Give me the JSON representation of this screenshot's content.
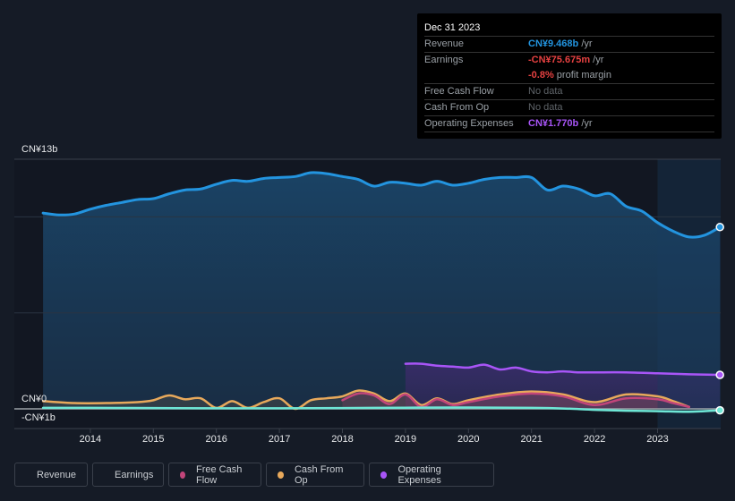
{
  "tooltip": {
    "date": "Dec 31 2023",
    "rows": [
      {
        "label": "Revenue",
        "value": "CN¥9.468b",
        "unit": " /yr"
      },
      {
        "label": "Earnings",
        "value": "-CN¥75.675m",
        "unit": " /yr"
      },
      {
        "label": "",
        "value": "-0.8%",
        "unit": " profit margin"
      },
      {
        "label": "Free Cash Flow",
        "value": "No data",
        "unit": ""
      },
      {
        "label": "Cash From Op",
        "value": "No data",
        "unit": ""
      },
      {
        "label": "Operating Expenses",
        "value": "CN¥1.770b",
        "unit": " /yr"
      }
    ]
  },
  "legend": [
    {
      "label": "Revenue",
      "color": "#2394df"
    },
    {
      "label": "Earnings",
      "color": "#6ee7d6"
    },
    {
      "label": "Free Cash Flow",
      "color": "#c2457a"
    },
    {
      "label": "Cash From Op",
      "color": "#e8a95b"
    },
    {
      "label": "Operating Expenses",
      "color": "#a855f7"
    }
  ],
  "chart_data": {
    "type": "area",
    "title": "",
    "xlabel": "",
    "ylabel": "",
    "y_tick_labels": [
      "CN¥13b",
      "CN¥0",
      "-CN¥1b"
    ],
    "x_tick_labels": [
      "2014",
      "2015",
      "2016",
      "2017",
      "2018",
      "2019",
      "2020",
      "2021",
      "2022",
      "2023"
    ],
    "ylim": [
      -1,
      13
    ],
    "xlim": [
      2013,
      2024
    ],
    "grid": true,
    "forecast_shading_from": 2023.0,
    "legend_position": "bottom-left",
    "series": [
      {
        "name": "Revenue",
        "color": "#2394df",
        "unit": "CN¥b",
        "x": [
          2013.25,
          2013.5,
          2013.75,
          2014.0,
          2014.25,
          2014.5,
          2014.75,
          2015.0,
          2015.25,
          2015.5,
          2015.75,
          2016.0,
          2016.25,
          2016.5,
          2016.75,
          2017.0,
          2017.25,
          2017.5,
          2017.75,
          2018.0,
          2018.25,
          2018.5,
          2018.75,
          2019.0,
          2019.25,
          2019.5,
          2019.75,
          2020.0,
          2020.25,
          2020.5,
          2020.75,
          2021.0,
          2021.25,
          2021.5,
          2021.75,
          2022.0,
          2022.25,
          2022.5,
          2022.75,
          2023.0,
          2023.25,
          2023.5,
          2023.75,
          2023.99
        ],
        "values": [
          10.2,
          10.1,
          10.15,
          10.4,
          10.6,
          10.75,
          10.9,
          10.95,
          11.2,
          11.4,
          11.45,
          11.7,
          11.9,
          11.85,
          12.0,
          12.05,
          12.1,
          12.3,
          12.25,
          12.1,
          11.95,
          11.6,
          11.8,
          11.75,
          11.65,
          11.85,
          11.65,
          11.75,
          11.95,
          12.05,
          12.05,
          12.05,
          11.4,
          11.6,
          11.45,
          11.1,
          11.2,
          10.55,
          10.3,
          9.7,
          9.25,
          8.95,
          9.05,
          9.468
        ]
      },
      {
        "name": "Earnings",
        "color": "#6ee7d6",
        "unit": "CN¥b",
        "x": [
          2013.25,
          2014.0,
          2015.0,
          2016.0,
          2017.0,
          2018.0,
          2019.0,
          2020.0,
          2021.0,
          2021.5,
          2022.0,
          2022.5,
          2023.0,
          2023.5,
          2023.99
        ],
        "values": [
          0.05,
          0.05,
          0.04,
          0.03,
          0.03,
          0.04,
          0.06,
          0.07,
          0.05,
          0.02,
          -0.05,
          -0.1,
          -0.12,
          -0.15,
          -0.076
        ]
      },
      {
        "name": "Free Cash Flow",
        "color": "#c2457a",
        "unit": "CN¥b",
        "x": [
          2018.0,
          2018.25,
          2018.5,
          2018.75,
          2019.0,
          2019.25,
          2019.5,
          2019.75,
          2020.0,
          2020.5,
          2021.0,
          2021.5,
          2022.0,
          2022.5,
          2023.0,
          2023.25,
          2023.5
        ],
        "values": [
          0.45,
          0.8,
          0.7,
          0.25,
          0.75,
          0.1,
          0.5,
          0.2,
          0.35,
          0.65,
          0.8,
          0.65,
          0.2,
          0.55,
          0.5,
          0.3,
          0.1
        ]
      },
      {
        "name": "Cash From Op",
        "color": "#e8a95b",
        "unit": "CN¥b",
        "x": [
          2013.25,
          2013.75,
          2014.25,
          2014.75,
          2015.0,
          2015.25,
          2015.5,
          2015.75,
          2016.0,
          2016.25,
          2016.5,
          2016.75,
          2017.0,
          2017.25,
          2017.5,
          2017.75,
          2018.0,
          2018.25,
          2018.5,
          2018.75,
          2019.0,
          2019.25,
          2019.5,
          2019.75,
          2020.0,
          2020.5,
          2021.0,
          2021.5,
          2022.0,
          2022.5,
          2023.0,
          2023.25,
          2023.5
        ],
        "values": [
          0.4,
          0.3,
          0.3,
          0.35,
          0.45,
          0.7,
          0.5,
          0.55,
          0.05,
          0.4,
          0.05,
          0.35,
          0.55,
          0.0,
          0.45,
          0.55,
          0.65,
          0.95,
          0.8,
          0.4,
          0.8,
          0.2,
          0.55,
          0.25,
          0.45,
          0.75,
          0.9,
          0.75,
          0.35,
          0.75,
          0.65,
          0.4,
          0.1
        ]
      },
      {
        "name": "Operating Expenses",
        "color": "#a855f7",
        "unit": "CN¥b",
        "x": [
          2019.0,
          2019.25,
          2019.5,
          2019.75,
          2020.0,
          2020.25,
          2020.5,
          2020.75,
          2021.0,
          2021.25,
          2021.5,
          2021.75,
          2022.0,
          2022.5,
          2023.0,
          2023.5,
          2023.99
        ],
        "values": [
          2.35,
          2.35,
          2.25,
          2.2,
          2.15,
          2.3,
          2.05,
          2.15,
          1.95,
          1.9,
          1.95,
          1.9,
          1.9,
          1.9,
          1.85,
          1.8,
          1.77
        ]
      }
    ]
  }
}
